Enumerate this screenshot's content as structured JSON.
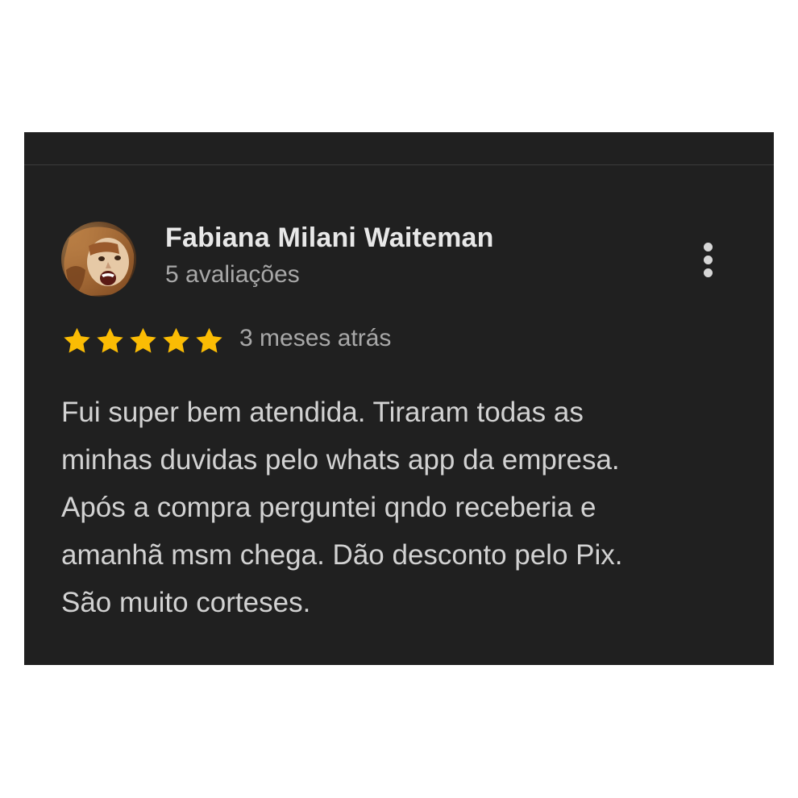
{
  "review": {
    "reviewer_name": "Fabiana Milani Waiteman",
    "review_count": "5 avaliações",
    "rating": 5,
    "rating_max": 5,
    "date": "3 meses atrás",
    "text_lines": [
      "Fui super bem atendida. Tiraram todas as",
      "minhas duvidas pelo whats app da empresa.",
      "Após a compra perguntei qndo receberia e",
      "amanhã msm chega. Dão desconto pelo Pix.",
      "São muito corteses."
    ]
  },
  "icons": {
    "avatar": "profile-photo",
    "menu": "more-vert-icon",
    "star": "star-icon"
  },
  "colors": {
    "card_background": "#202020",
    "star": "#fbbc04",
    "name_text": "#e8e8e8",
    "secondary_text": "#a8a8a8",
    "body_text": "#d2d2d2"
  }
}
